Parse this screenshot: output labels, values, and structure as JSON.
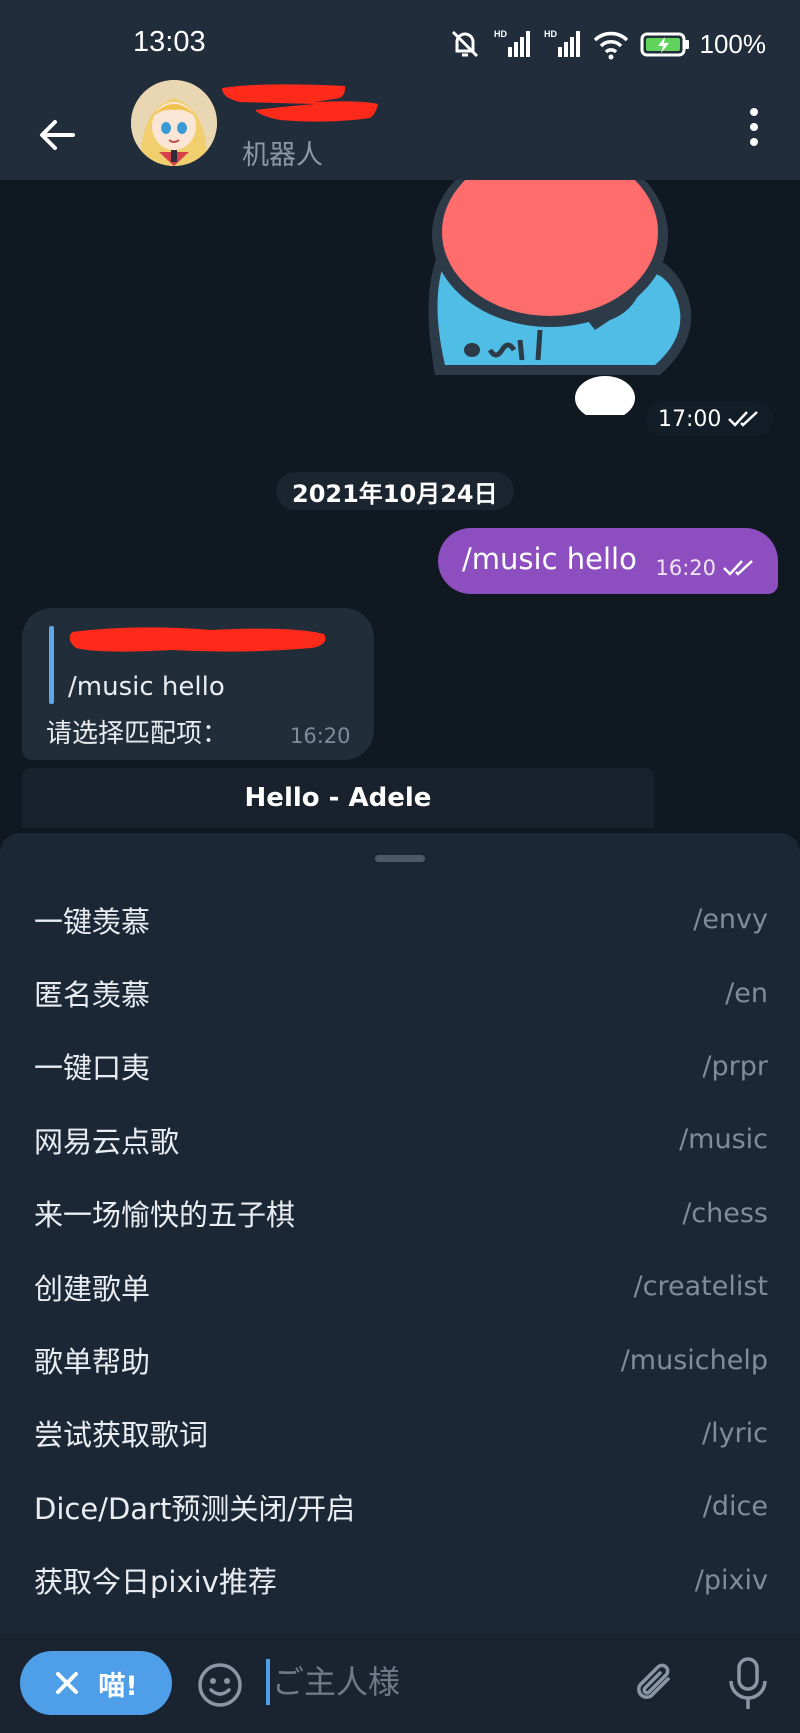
{
  "status_bar": {
    "time": "13:03",
    "battery": "100%",
    "hd_label": "HD"
  },
  "header": {
    "subtitle": "机器人"
  },
  "messages": {
    "sticker_time": "17:00",
    "date_divider": "2021年10月24日",
    "outgoing": {
      "text": "/music hello",
      "time": "16:20"
    },
    "incoming": {
      "reply_quote": "/music hello",
      "text": "请选择匹配项：",
      "time": "16:20"
    },
    "inline_button": "Hello - Adele"
  },
  "commands": [
    {
      "desc": "一键羡慕",
      "cmd": "/envy"
    },
    {
      "desc": "匿名羡慕",
      "cmd": "/en"
    },
    {
      "desc": "一键口夷",
      "cmd": "/prpr"
    },
    {
      "desc": "网易云点歌",
      "cmd": "/music"
    },
    {
      "desc": "来一场愉快的五子棋",
      "cmd": "/chess"
    },
    {
      "desc": "创建歌单",
      "cmd": "/createlist"
    },
    {
      "desc": "歌单帮助",
      "cmd": "/musichelp"
    },
    {
      "desc": "尝试获取歌词",
      "cmd": "/lyric"
    },
    {
      "desc": "Dice/Dart预测关闭/开启",
      "cmd": "/dice"
    },
    {
      "desc": "获取今日pixiv推荐",
      "cmd": "/pixiv"
    }
  ],
  "input_bar": {
    "bot_button": "喵!",
    "placeholder": "ご主人様"
  },
  "colors": {
    "accent": "#4f9fe8",
    "outgoing_bubble": "#8d4fbf",
    "header_bg": "#212d3b",
    "chat_bg": "#101821",
    "redaction": "#ff2a1a"
  },
  "icons": {
    "back": "arrow-left-icon",
    "menu": "more-vertical-icon",
    "read": "double-check-icon",
    "emoji": "smile-icon",
    "attach": "paperclip-icon",
    "mic": "microphone-icon",
    "close": "close-icon"
  }
}
